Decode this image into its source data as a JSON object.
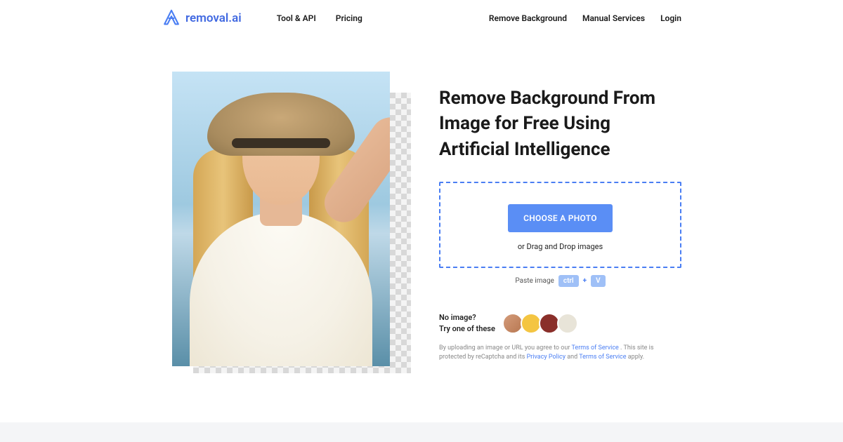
{
  "brand": "removal.ai",
  "nav": {
    "left": [
      "Tool & API",
      "Pricing"
    ],
    "right": [
      "Remove Background",
      "Manual Services",
      "Login"
    ]
  },
  "hero": {
    "headline": "Remove Background From Image for Free Using Artificial Intelligence"
  },
  "dropzone": {
    "button": "CHOOSE A PHOTO",
    "dnd": "or Drag and Drop images"
  },
  "paste": {
    "label": "Paste image",
    "key1": "ctrl",
    "plus": "+",
    "key2": "V"
  },
  "samples": {
    "line1": "No image?",
    "line2": "Try one of these"
  },
  "legal": {
    "part1": "By uploading an image or URL you agree to our ",
    "tos": "Terms of Service",
    "part2": " . This site is protected by reCaptcha and its ",
    "privacy": "Privacy Policy",
    "and": " and ",
    "tos2": "Terms of Service",
    "apply": " apply."
  }
}
